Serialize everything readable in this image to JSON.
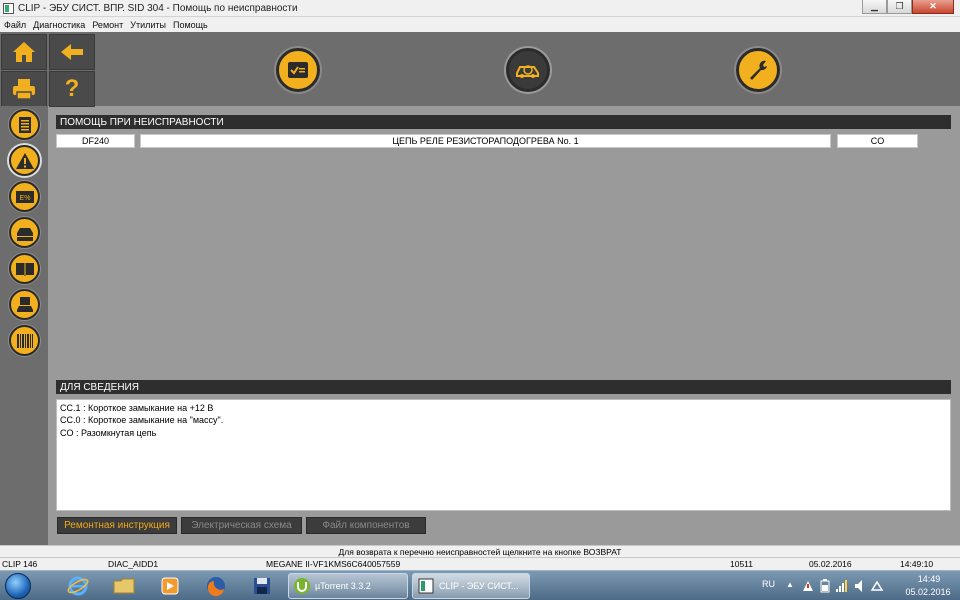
{
  "window": {
    "title": "CLIP - ЭБУ СИСТ. ВПР. SID 304 - Помощь по неисправности",
    "minimize_glyph": "▁",
    "maximize_glyph": "❐",
    "close_glyph": "✕"
  },
  "menu": {
    "items": [
      "Файл",
      "Диагностика",
      "Ремонт",
      "Утилиты",
      "Помощь"
    ]
  },
  "toolbar": {
    "help_glyph": "?",
    "icons": [
      "home-icon",
      "back-arrow-icon",
      "printer-icon",
      "help-icon",
      "checklist-icon",
      "car-diagnostic-icon",
      "wrench-icon"
    ]
  },
  "sidebar": {
    "icons": [
      "document-icon",
      "warning-icon",
      "parameters-icon",
      "vehicle-data-icon",
      "manual-icon",
      "vehicle-save-icon",
      "barcode-icon"
    ]
  },
  "fault_section": {
    "header": "ПОМОЩЬ ПРИ НЕИСПРАВНОСТИ",
    "code": "DF240",
    "description": "ЦЕПЬ РЕЛЕ РЕЗИСТОРАПОДОГРЕВА No. 1",
    "status": "CO"
  },
  "info_section": {
    "header": "ДЛЯ СВЕДЕНИЯ",
    "lines": [
      "CC.1  :  Короткое замыкание на +12 В",
      "CC.0  :  Короткое замыкание на \"массу\".",
      "CO  :  Разомкнутая цепь"
    ]
  },
  "bottom_tabs": [
    {
      "label": "Ремонтная инструкция",
      "active": true
    },
    {
      "label": "Электрическая схема",
      "active": false
    },
    {
      "label": "Файл компонентов",
      "active": false
    }
  ],
  "status": {
    "message": "Для возврата к перечню неисправностей щелкните на кнопке ВОЗВРАТ",
    "clip": "CLIP 146",
    "diag": "DIAC_AIDD1",
    "vehicle": "MEGANE II-VF1KMS6C640057559",
    "number": "10511",
    "date": "05.02.2016",
    "time": "14:49:10"
  },
  "taskbar": {
    "apps": [
      "internet-explorer-icon",
      "file-explorer-icon",
      "media-player-icon",
      "firefox-icon",
      "floppy-save-icon"
    ],
    "windows": [
      {
        "label": "µTorrent 3.3.2"
      },
      {
        "label": "CLIP - ЭБУ СИСТ..."
      }
    ],
    "tray": {
      "lang": "RU",
      "show_hidden_glyph": "▲",
      "clock_time": "14:49",
      "clock_date": "05.02.2016"
    }
  },
  "colors": {
    "accent": "#f2b01e",
    "panel": "#9a9a9a",
    "chrome": "#6d6d6d",
    "header": "#2e2e2e",
    "active_tab_text": "#f2a81d",
    "inactive_tab_text": "#8a8a8a"
  }
}
